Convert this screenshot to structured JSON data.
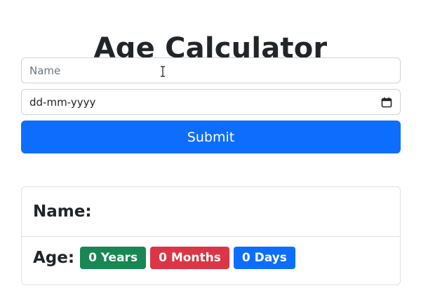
{
  "header": {
    "title": "Age Calculator"
  },
  "form": {
    "name_placeholder": "Name",
    "name_value": "",
    "date_placeholder": "dd-mm-yyyy",
    "submit_label": "Submit"
  },
  "result": {
    "name_label": "Name:",
    "name_value": "",
    "age_label": "Age:",
    "badges": [
      {
        "text": "0 Years",
        "color": "#198754"
      },
      {
        "text": "0 Months",
        "color": "#dc3545"
      },
      {
        "text": "0 Days",
        "color": "#0d6efd"
      }
    ]
  },
  "colors": {
    "primary": "#0d6efd",
    "success": "#198754",
    "danger": "#dc3545"
  },
  "icons": {
    "calendar": "calendar-icon",
    "cursor": "text-cursor-icon"
  }
}
